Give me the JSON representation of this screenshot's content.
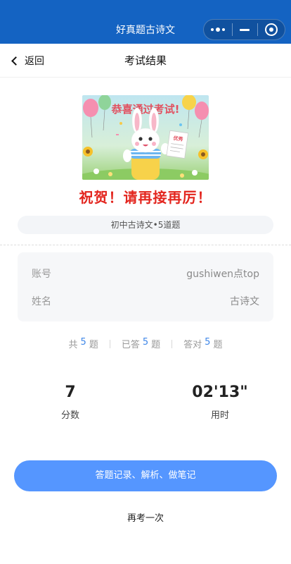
{
  "app_bar": {
    "title": "好真题古诗文",
    "capsule_icons": [
      "more-dots-icon",
      "minimize-icon",
      "close-target-icon"
    ]
  },
  "nav": {
    "back_label": "返回",
    "title": "考试结果"
  },
  "banner": {
    "headline": "恭喜通过考试!",
    "certificate_text": "优秀",
    "icon": "bunny-with-certificate-illustration"
  },
  "result": {
    "congrats": "祝贺！请再接再厉！",
    "exam_name": "初中古诗文•5道题"
  },
  "info": {
    "account_label": "账号",
    "account_value": "gushiwen点top",
    "name_label": "姓名",
    "name_value": "古诗文"
  },
  "stats": {
    "total_prefix": "共",
    "total": "5",
    "total_suffix": "题",
    "answered_prefix": "已答",
    "answered": "5",
    "answered_suffix": "题",
    "correct_prefix": "答对",
    "correct": "5",
    "correct_suffix": "题"
  },
  "score": {
    "value": "7",
    "label": "分数"
  },
  "time": {
    "value": "02'13\"",
    "label": "用时"
  },
  "actions": {
    "records_label": "答题记录、解析、做笔记",
    "retake_label": "再考一次"
  },
  "colors": {
    "app_bar": "#1463c2",
    "congrats": "#e3251e",
    "primary_button": "#5596ff",
    "stat_number": "#3f87e8"
  }
}
